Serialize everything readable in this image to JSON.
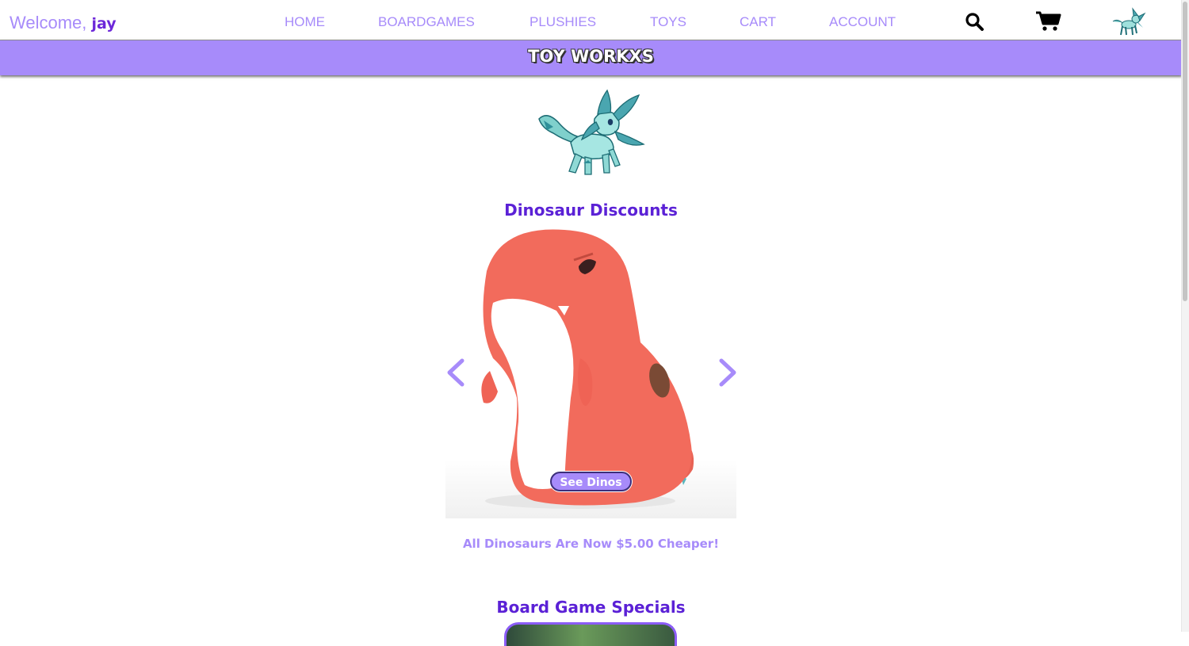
{
  "header": {
    "welcome_prefix": "Welcome,",
    "username": "jay",
    "nav": [
      "HOME",
      "BOARDGAMES",
      "PLUSHIES",
      "TOYS",
      "CART",
      "ACCOUNT"
    ],
    "icons": [
      "search-icon",
      "cart-icon",
      "glaceon-avatar-icon"
    ]
  },
  "brand": {
    "title": "TOY WORKXS"
  },
  "sections": {
    "dino": {
      "title": "Dinosaur Discounts",
      "button_label": "See Dinos",
      "promo_text": "All Dinosaurs Are Now $5.00 Cheaper!"
    },
    "boardgames": {
      "title": "Board Game Specials"
    }
  },
  "colors": {
    "accent": "#a78bfa",
    "accent_dark": "#5b21d6",
    "plush_body": "#f26b5c",
    "plush_belly": "#ffffff",
    "mascot": "#8fd6d2"
  }
}
